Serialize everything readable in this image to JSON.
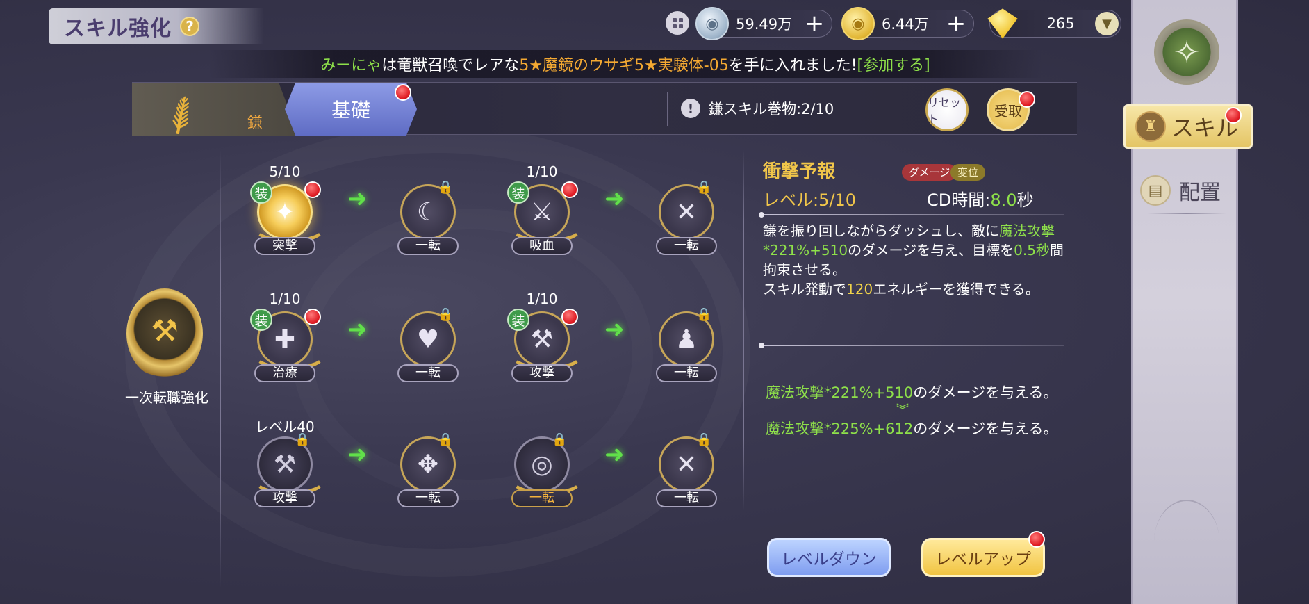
{
  "header": {
    "title": "スキル強化",
    "help_icon": "?"
  },
  "currency": {
    "silver": {
      "value": "59.49万",
      "plus": "+"
    },
    "gold": {
      "value": "6.44万",
      "plus": "+"
    },
    "gem": {
      "value": "265",
      "dropdown": "▼"
    }
  },
  "announcement": {
    "player": "みーにゃ",
    "text1": "は竜獣召喚でレアな",
    "item1": "5★魔鏡のウサギ",
    "item2": "5★実験体-05",
    "text2": "を手に入れました!",
    "join": "[参加する]"
  },
  "tabs": {
    "weapon_label": "鎌",
    "basic_label": "基礎",
    "scroll_info": "鎌スキル巻物:2/10",
    "exclaim": "!",
    "reset_label": "リセット",
    "receive_label": "受取"
  },
  "class": {
    "label": "一次転職強化"
  },
  "skills": {
    "r1a": {
      "level": "5/10",
      "name": "突撃",
      "equip": "装",
      "icon": "✦"
    },
    "r1b": {
      "name": "一転",
      "icon": "☾"
    },
    "r1c": {
      "level": "1/10",
      "name": "吸血",
      "equip": "装",
      "icon": "⚔"
    },
    "r1d": {
      "name": "一転",
      "icon": "✕"
    },
    "r2a": {
      "level": "1/10",
      "name": "治療",
      "equip": "装",
      "icon": "✚"
    },
    "r2b": {
      "name": "一転",
      "icon": "♥"
    },
    "r2c": {
      "level": "1/10",
      "name": "攻撃",
      "equip": "装",
      "icon": "⚒"
    },
    "r2d": {
      "name": "一転",
      "icon": "♟"
    },
    "r3a": {
      "level": "レベル40",
      "name": "攻撃",
      "icon": "⚒"
    },
    "r3b": {
      "name": "一転",
      "icon": "✥"
    },
    "r3c": {
      "name": "一転",
      "icon": "◎"
    },
    "r3d": {
      "name": "一転",
      "icon": "✕"
    }
  },
  "detail": {
    "title": "衝撃予報",
    "tag_damage": "ダメージ",
    "tag_displace": "変位",
    "level": "レベル:5/10",
    "cd_label": "CD時間:",
    "cd_value": "8.0",
    "cd_unit": "秒",
    "desc_1": "鎌を振り回しながらダッシュし、敵に",
    "desc_formula": "魔法攻撃*221%+510",
    "desc_2": "のダメージを与え、目標を",
    "desc_time": "0.5秒",
    "desc_3": "間拘束させる。",
    "desc_4": "スキル発動で",
    "desc_energy": "120",
    "desc_5": "エネルギーを獲得できる。",
    "up_current_formula": "魔法攻撃*221%+510",
    "up_current_text": "のダメージを与える。",
    "up_next_formula": "魔法攻撃*225%+612",
    "up_next_text": "のダメージを与える。"
  },
  "buttons": {
    "level_down": "レベルダウン",
    "level_up": "レベルアップ"
  },
  "sidebar": {
    "skill_label": "スキル",
    "placement_label": "配置"
  },
  "colors": {
    "accent_gold": "#f1c64a",
    "accent_green": "#8ee04a",
    "alert_red": "#e01c24"
  }
}
